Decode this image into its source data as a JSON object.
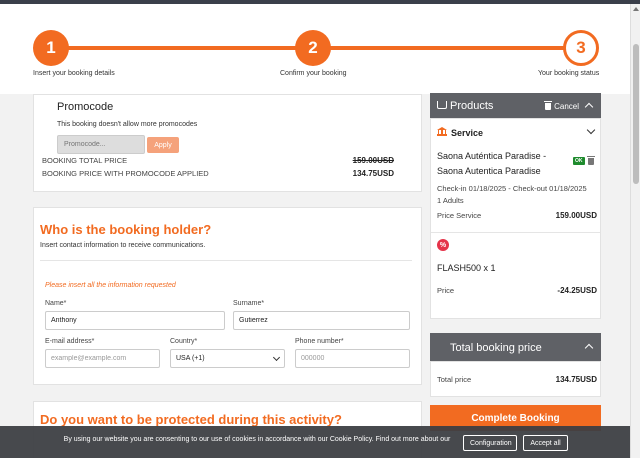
{
  "stepper": {
    "steps": [
      {
        "number": "1",
        "label": "Insert your booking details"
      },
      {
        "number": "2",
        "label": "Confirm your booking"
      },
      {
        "number": "3",
        "label": "Your booking status"
      }
    ]
  },
  "promo": {
    "title": "Promocode",
    "note": "This booking doesn't allow more promocodes",
    "placeholder": "Promocode...",
    "apply_label": "Apply",
    "total_label": "BOOKING TOTAL PRICE",
    "total_value": "159.00USD",
    "promo_label": "BOOKING PRICE WITH PROMOCODE APPLIED",
    "promo_value": "134.75USD"
  },
  "holder": {
    "title": "Who is the booking holder?",
    "subtitle": "Insert contact information to receive communications.",
    "warning": "Please insert all the information requested",
    "name_label": "Name*",
    "name_value": "Anthony",
    "surname_label": "Surname*",
    "surname_value": "Gutierrez",
    "email_label": "E-mail address*",
    "email_placeholder": "example@example.com",
    "country_label": "Country*",
    "country_value": "USA (+1)",
    "phone_label": "Phone number*",
    "phone_placeholder": "000000"
  },
  "protect": {
    "title": "Do you want to be protected during this activity?"
  },
  "products": {
    "title": "Products",
    "cancel_label": "Cancel",
    "service_label": "Service",
    "product_line1": "Saona Auténtica Paradise -",
    "product_line2": "Saona Autentica Paradise",
    "ok_badge": "OK",
    "dates": "Check-in 01/18/2025 - Check-out 01/18/2025",
    "adults": "1 Adults",
    "price_service_label": "Price Service",
    "price_service_value": "159.00USD",
    "discount_icon": "%",
    "discount_name": "FLASH500 x 1",
    "price_label": "Price",
    "price_value": "-24.25USD"
  },
  "total": {
    "title": "Total booking price",
    "label": "Total price",
    "value": "134.75USD"
  },
  "complete_label": "Complete Booking",
  "cookie": {
    "text": "By using our website you are consenting to our use of cookies in accordance with our Cookie Policy. Find out more about our",
    "configuration_label": "Configuration",
    "accept_label": "Accept all"
  },
  "colors": {
    "accent": "#f26b21",
    "header_gray": "#5f6166",
    "ok_green": "#1e8b2d"
  },
  "icons": [
    "cart-icon",
    "trash-icon",
    "bank-icon",
    "percent-icon",
    "chevron-up-icon",
    "chevron-down-icon"
  ]
}
